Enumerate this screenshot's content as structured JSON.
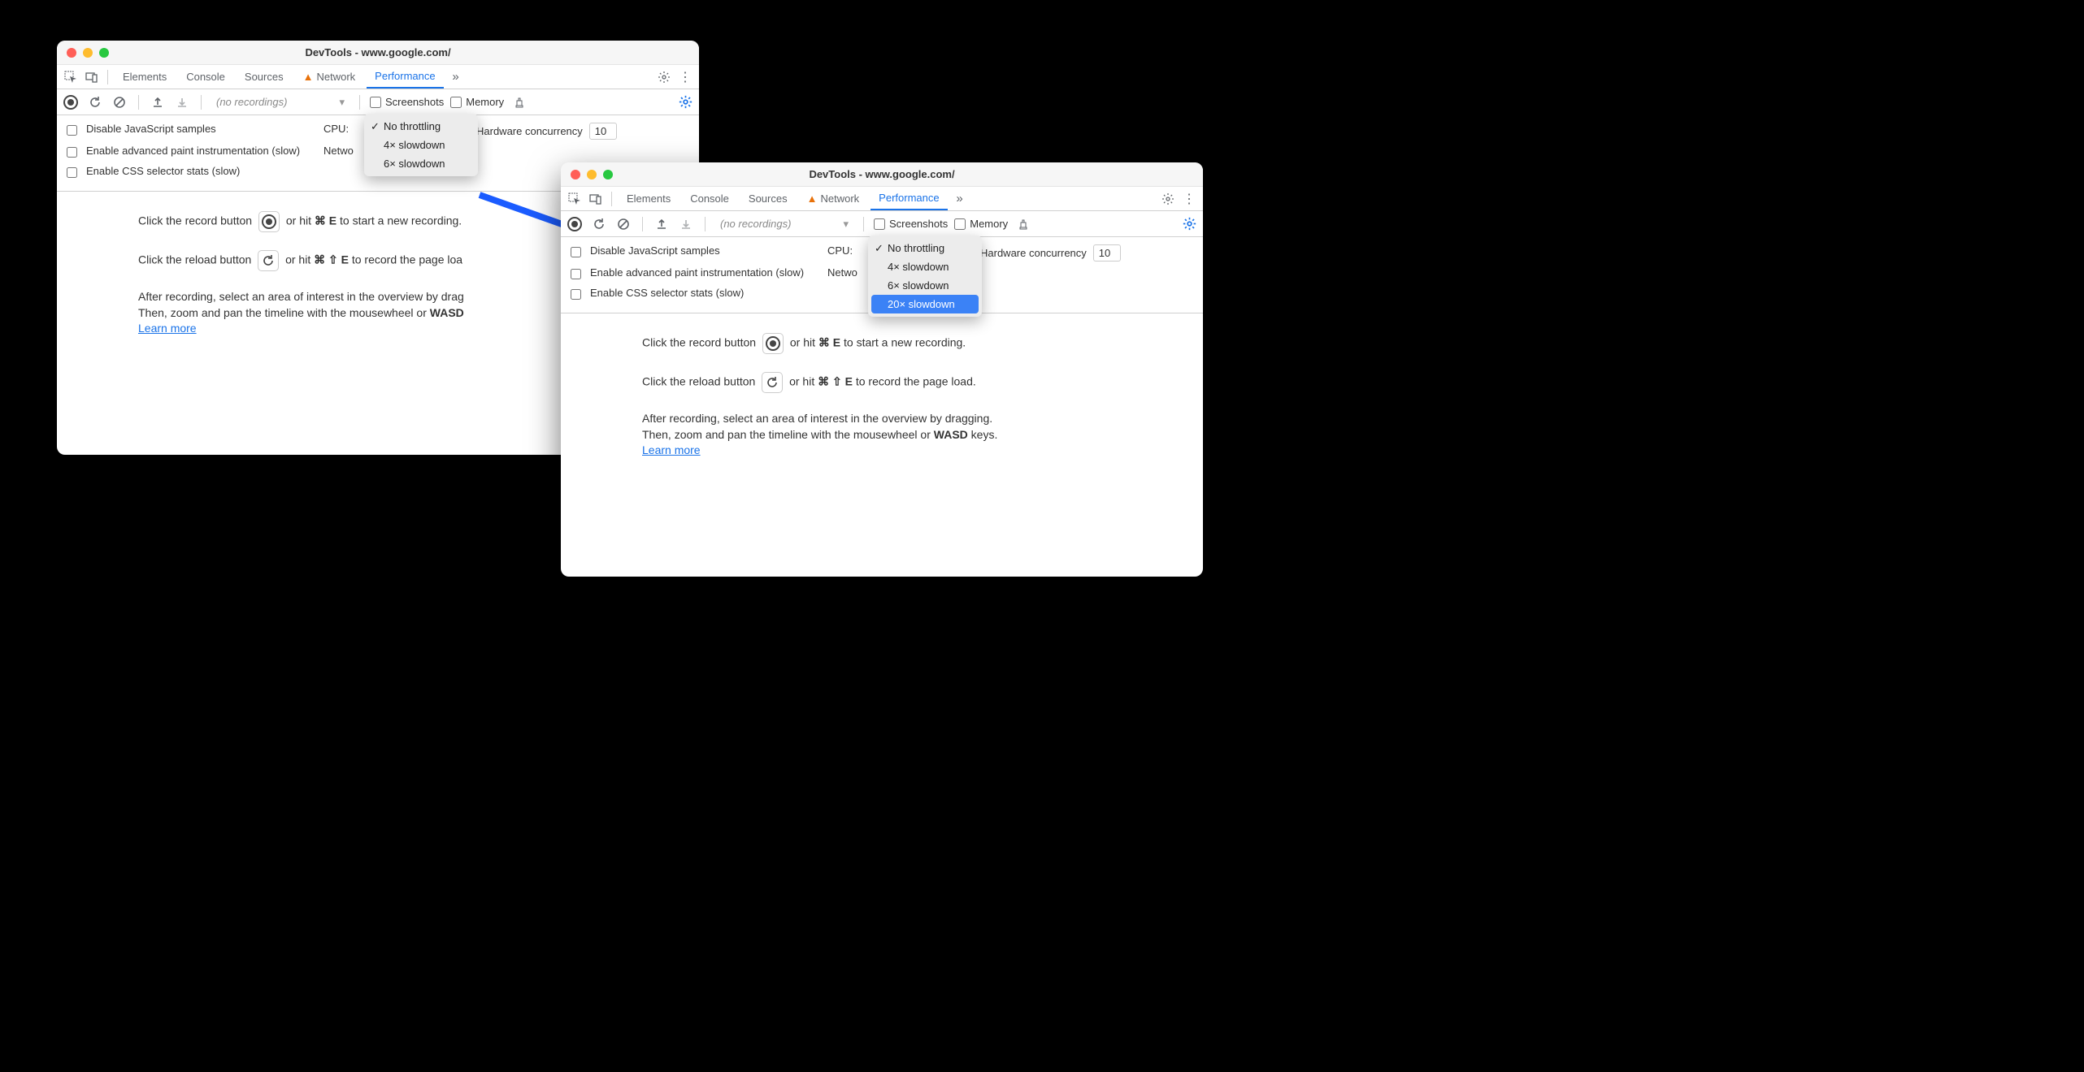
{
  "window1": {
    "title": "DevTools - www.google.com/",
    "tabs": [
      "Elements",
      "Console",
      "Sources",
      "Network",
      "Performance"
    ],
    "active_tab": "Performance",
    "no_recordings": "(no recordings)",
    "screenshots_label": "Screenshots",
    "memory_label": "Memory",
    "settings": {
      "disable_js": "Disable JavaScript samples",
      "enable_paint": "Enable advanced paint instrumentation (slow)",
      "enable_css": "Enable CSS selector stats (slow)",
      "cpu_label": "CPU:",
      "network_label": "Network:",
      "hw_label": "Hardware concurrency",
      "hw_value": "10"
    },
    "dropdown": [
      "No throttling",
      "4× slowdown",
      "6× slowdown"
    ],
    "body": {
      "line1a": "Click the record button ",
      "line1b": " or hit ",
      "line1_key": "⌘ E",
      "line1c": " to start a new recording.",
      "line2a": "Click the reload button ",
      "line2b": " or hit ",
      "line2_key": "⌘ ⇧ E",
      "line2c": " to record the page loa",
      "para_a": "After recording, select an area of interest in the overview by drag",
      "para_b": "Then, zoom and pan the timeline with the mousewheel or ",
      "wasd": "WASD",
      "learn_more": "Learn more"
    }
  },
  "window2": {
    "title": "DevTools - www.google.com/",
    "tabs": [
      "Elements",
      "Console",
      "Sources",
      "Network",
      "Performance"
    ],
    "active_tab": "Performance",
    "no_recordings": "(no recordings)",
    "screenshots_label": "Screenshots",
    "memory_label": "Memory",
    "settings": {
      "disable_js": "Disable JavaScript samples",
      "enable_paint": "Enable advanced paint instrumentation (slow)",
      "enable_css": "Enable CSS selector stats (slow)",
      "cpu_label": "CPU:",
      "network_label": "Network:",
      "hw_label": "Hardware concurrency",
      "hw_value": "10"
    },
    "dropdown": [
      "No throttling",
      "4× slowdown",
      "6× slowdown",
      "20× slowdown"
    ],
    "body": {
      "line1a": "Click the record button ",
      "line1b": " or hit ",
      "line1_key": "⌘ E",
      "line1c": " to start a new recording.",
      "line2a": "Click the reload button ",
      "line2b": " or hit ",
      "line2_key": "⌘ ⇧ E",
      "line2c": " to record the page load.",
      "para_a": "After recording, select an area of interest in the overview by dragging.",
      "para_b": "Then, zoom and pan the timeline with the mousewheel or ",
      "wasd": "WASD",
      "para_c": " keys.",
      "learn_more": "Learn more"
    }
  }
}
